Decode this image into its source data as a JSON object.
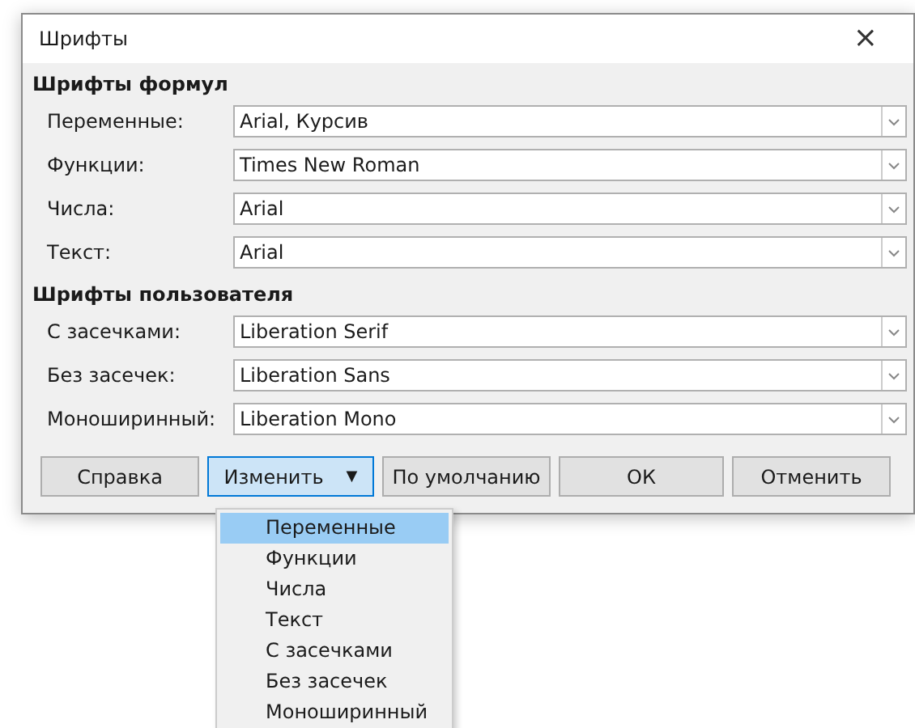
{
  "window": {
    "title": "Шрифты",
    "close": "×"
  },
  "sections": [
    {
      "title": "Шрифты формул",
      "rows": [
        {
          "label": "Переменные:",
          "value": "Arial, Курсив"
        },
        {
          "label": "Функции:",
          "value": "Times New Roman"
        },
        {
          "label": "Числа:",
          "value": "Arial"
        },
        {
          "label": "Текст:",
          "value": "Arial"
        }
      ]
    },
    {
      "title": "Шрифты пользователя",
      "rows": [
        {
          "label": "С засечками:",
          "value": "Liberation Serif"
        },
        {
          "label": "Без засечек:",
          "value": "Liberation Sans"
        },
        {
          "label": "Моноширинный:",
          "value": "Liberation Mono"
        }
      ]
    }
  ],
  "buttons": [
    {
      "kind": "plain",
      "label": "Справка",
      "focused": false
    },
    {
      "kind": "menu",
      "label": "Изменить",
      "focused": true,
      "caret": "▼"
    },
    {
      "kind": "plain",
      "label": "По умолчанию",
      "focused": false
    },
    {
      "kind": "plain",
      "label": "ОК",
      "focused": false
    },
    {
      "kind": "plain",
      "label": "Отменить",
      "focused": false
    }
  ],
  "menu": {
    "items": [
      {
        "label": "Переменные",
        "selected": true
      },
      {
        "label": "Функции",
        "selected": false
      },
      {
        "label": "Числа",
        "selected": false
      },
      {
        "label": "Текст",
        "selected": false
      },
      {
        "label": "С засечками",
        "selected": false
      },
      {
        "label": "Без засечек",
        "selected": false
      },
      {
        "label": "Моноширинный",
        "selected": false
      }
    ]
  }
}
